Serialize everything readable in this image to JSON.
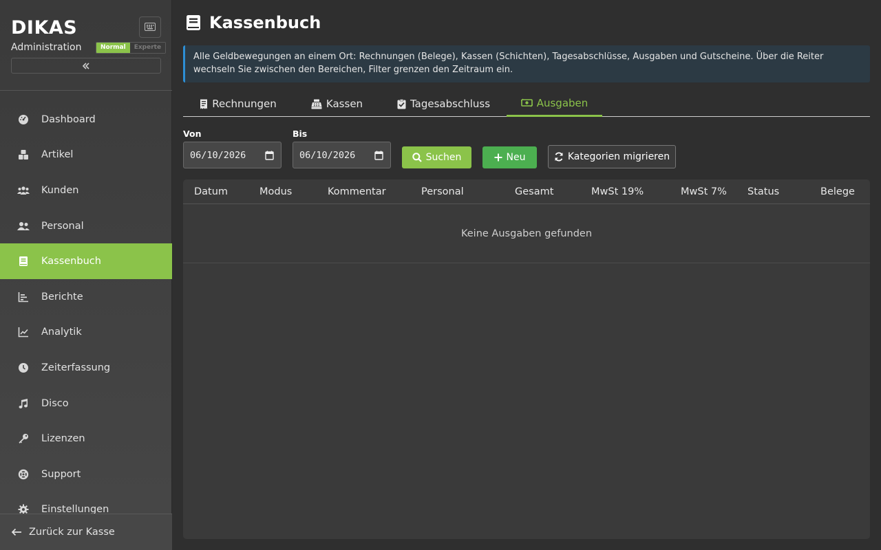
{
  "brand": {
    "logo": "DIKAS",
    "subtitle": "Administration"
  },
  "mode": {
    "normal": "Normal",
    "expert": "Experte"
  },
  "sidebar": {
    "items": [
      {
        "label": "Dashboard",
        "icon": "dashboard-icon"
      },
      {
        "label": "Artikel",
        "icon": "boxes-icon"
      },
      {
        "label": "Kunden",
        "icon": "users-icon"
      },
      {
        "label": "Personal",
        "icon": "user-group-icon"
      },
      {
        "label": "Kassenbuch",
        "icon": "book-icon",
        "active": true
      },
      {
        "label": "Berichte",
        "icon": "bar-chart-icon"
      },
      {
        "label": "Analytik",
        "icon": "line-chart-icon"
      },
      {
        "label": "Zeiterfassung",
        "icon": "clock-icon"
      },
      {
        "label": "Disco",
        "icon": "music-icon"
      },
      {
        "label": "Lizenzen",
        "icon": "key-icon"
      },
      {
        "label": "Support",
        "icon": "lifebuoy-icon"
      },
      {
        "label": "Einstellungen",
        "icon": "gear-icon"
      }
    ],
    "footer": "Zurück zur Kasse"
  },
  "page": {
    "title": "Kassenbuch",
    "info": "Alle Geldbewegungen an einem Ort: Rechnungen (Belege), Kassen (Schichten), Tagesabschlüsse, Ausgaben und Gutscheine. Über die Reiter wechseln Sie zwischen den Bereichen, Filter grenzen den Zeitraum ein."
  },
  "tabs": [
    {
      "label": "Rechnungen",
      "icon": "receipt-icon"
    },
    {
      "label": "Kassen",
      "icon": "cash-register-icon"
    },
    {
      "label": "Tagesabschluss",
      "icon": "clipboard-check-icon"
    },
    {
      "label": "Ausgaben",
      "icon": "money-bill-icon",
      "active": true
    }
  ],
  "filters": {
    "from_label": "Von",
    "from_value": "06/10/2026",
    "to_label": "Bis",
    "to_value": "06/10/2026"
  },
  "buttons": {
    "search": "Suchen",
    "new": "Neu",
    "migrate": "Kategorien migrieren"
  },
  "table": {
    "columns": [
      "Datum",
      "Modus",
      "Kommentar",
      "Personal",
      "Gesamt",
      "MwSt 19%",
      "MwSt 7%",
      "Status",
      "Belege"
    ],
    "empty": "Keine Ausgaben gefunden"
  },
  "colors": {
    "accent": "#8bc34a",
    "new_button": "#4caf50",
    "info_border": "#2d8fd5"
  }
}
